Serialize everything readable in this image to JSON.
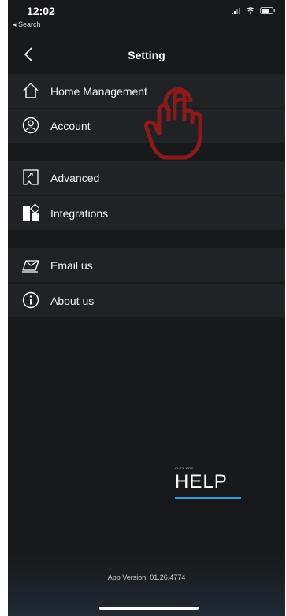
{
  "status_bar": {
    "time": "12:02",
    "back_app": "◂ Search"
  },
  "nav": {
    "title": "Setting"
  },
  "menu": {
    "home_management": "Home Management",
    "account": "Account",
    "advanced": "Advanced",
    "integrations": "Integrations",
    "email_us": "Email us",
    "about_us": "About us"
  },
  "help": {
    "small": "CLICK FOR",
    "big": "HELP"
  },
  "footer": {
    "version": "App Version:  01.26.4774"
  },
  "colors": {
    "background": "#18191b",
    "row": "#212226",
    "accent": "#3c9adf",
    "tap_hand": "#8b1a1a"
  },
  "icons": [
    "wifi-icon",
    "signal-icon",
    "battery-icon",
    "back-chevron-icon",
    "home-icon",
    "account-icon",
    "advanced-icon",
    "integrations-icon",
    "email-icon",
    "info-icon",
    "tap-hand-icon"
  ]
}
